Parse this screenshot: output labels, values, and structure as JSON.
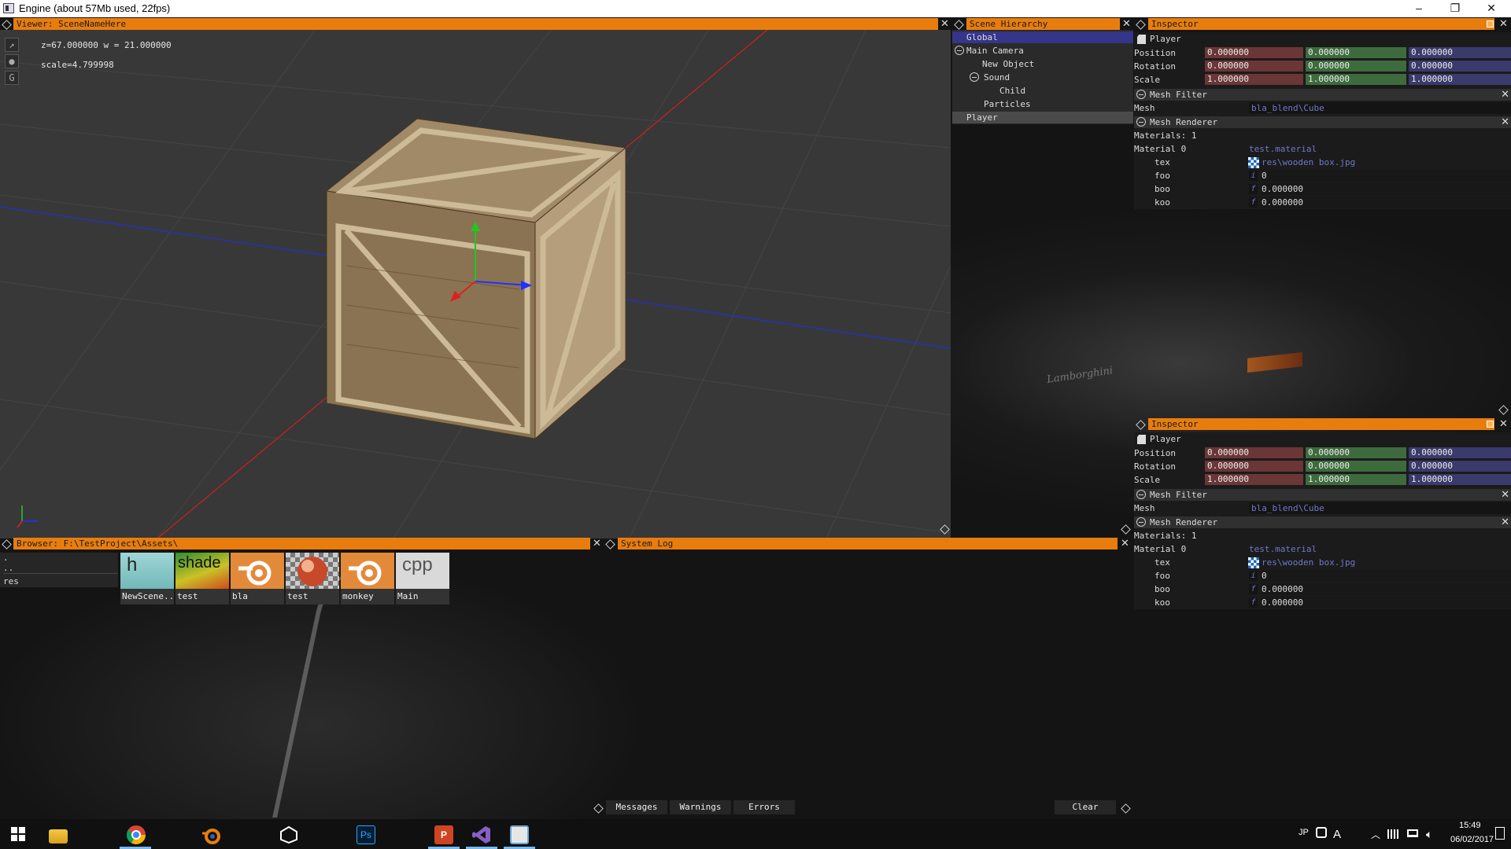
{
  "window": {
    "title": "Engine (about 57Mb used, 22fps)",
    "minimize": "–",
    "maximize": "❐",
    "close": "✕"
  },
  "viewer": {
    "title": "Viewer: SceneNameHere",
    "zw": "z=67.000000 w = 21.000000",
    "scale": "scale=4.799998",
    "tools": [
      "↗",
      "●",
      "G"
    ],
    "axis_mini": {
      "y": "y",
      "x": "x"
    }
  },
  "hierarchy": {
    "title": "Scene Hierarchy",
    "items": [
      {
        "label": "Global",
        "selected": true
      },
      {
        "label": "Main Camera",
        "collapsible": true
      },
      {
        "label": "New Object"
      },
      {
        "label": "Sound",
        "collapsible": true
      },
      {
        "label": "Child"
      },
      {
        "label": "Particles"
      },
      {
        "label": "Player",
        "highlighted": true
      }
    ]
  },
  "inspector": {
    "title": "Inspector",
    "object_name": "Player",
    "position_label": "Position",
    "rotation_label": "Rotation",
    "scale_label": "Scale",
    "position": [
      "0.000000",
      "0.000000",
      "0.000000"
    ],
    "rotation": [
      "0.000000",
      "0.000000",
      "0.000000"
    ],
    "scale": [
      "1.000000",
      "1.000000",
      "1.000000"
    ],
    "mesh_filter": {
      "title": "Mesh Filter",
      "mesh_label": "Mesh",
      "mesh_value": "bla_blend\\Cube"
    },
    "mesh_renderer": {
      "title": "Mesh Renderer",
      "materials_count": "Materials: 1",
      "material0_label": "Material 0",
      "material0_value": "test.material",
      "props": [
        {
          "name": "tex",
          "type": "texture",
          "value": "res\\wooden box.jpg"
        },
        {
          "name": "foo",
          "type": "int",
          "icon": "i",
          "value": "0"
        },
        {
          "name": "boo",
          "type": "float",
          "icon": "f",
          "value": "0.000000"
        },
        {
          "name": "koo",
          "type": "float",
          "icon": "f",
          "value": "0.000000"
        }
      ]
    }
  },
  "browser": {
    "title": "Browser: F:\\TestProject\\Assets\\",
    "folders": [
      ".",
      "..",
      "res"
    ],
    "files": [
      {
        "label": "NewScene..",
        "glyph": "h"
      },
      {
        "label": "test",
        "glyph": "shade"
      },
      {
        "label": "bla",
        "glyph": "blender"
      },
      {
        "label": "test",
        "glyph": "material"
      },
      {
        "label": "monkey",
        "glyph": "blender"
      },
      {
        "label": "Main",
        "glyph": "cpp"
      }
    ]
  },
  "syslog": {
    "title": "System Log",
    "buttons": {
      "messages": "Messages",
      "warnings": "Warnings",
      "errors": "Errors",
      "clear": "Clear"
    }
  },
  "taskbar": {
    "lang": "JP",
    "ime": "A",
    "time": "15:49",
    "date": "06/02/2017"
  },
  "watermark": "Lamborghini"
}
